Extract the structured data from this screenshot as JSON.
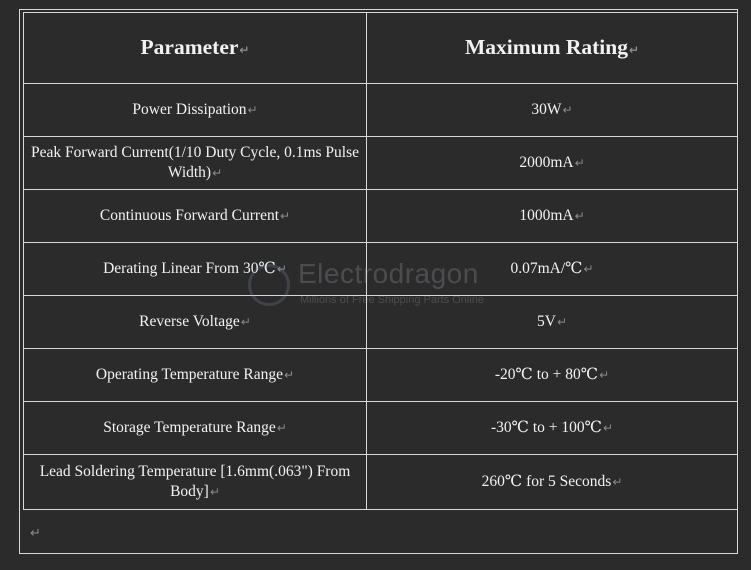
{
  "table": {
    "headers": [
      "Parameter",
      "Maximum Rating"
    ],
    "rows": [
      {
        "parameter": "Power Dissipation",
        "rating": "30W"
      },
      {
        "parameter": "Peak Forward Current(1/10 Duty Cycle, 0.1ms Pulse Width)",
        "rating": "2000mA"
      },
      {
        "parameter": "Continuous Forward Current",
        "rating": "1000mA"
      },
      {
        "parameter": "Derating Linear From 30℃",
        "rating": "0.07mA/℃"
      },
      {
        "parameter": "Reverse Voltage",
        "rating": "5V"
      },
      {
        "parameter": "Operating Temperature Range",
        "rating": "-20℃  to + 80℃"
      },
      {
        "parameter": "Storage Temperature Range",
        "rating": "-30℃  to + 100℃"
      },
      {
        "parameter": "Lead Soldering Temperature [1.6mm(.063\") From Body]",
        "rating": "260℃  for 5 Seconds"
      }
    ]
  },
  "paragraph_mark": "↵",
  "watermark": {
    "title": "Electrodragon",
    "subtitle": "Millions of Free Shipping Parts Online"
  }
}
